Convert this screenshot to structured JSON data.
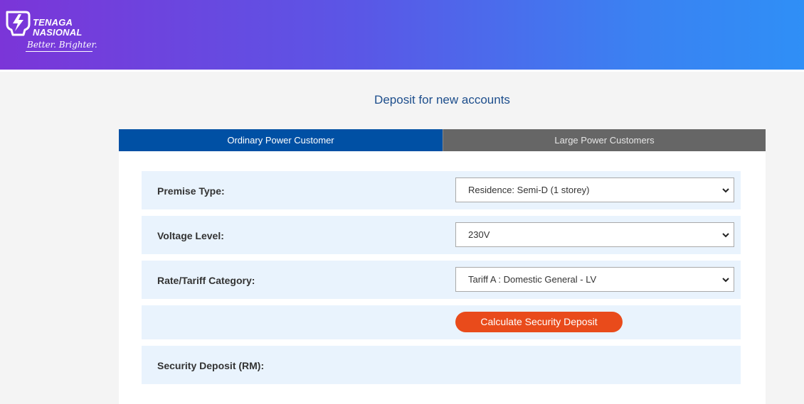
{
  "brand": {
    "name_line1": "TENAGA",
    "name_line2": "NASIONAL",
    "tagline": "Better. Brighter."
  },
  "page": {
    "title": "Deposit for new accounts"
  },
  "tabs": [
    {
      "label": "Ordinary Power Customer",
      "active": true
    },
    {
      "label": "Large Power Customers",
      "active": false
    }
  ],
  "form": {
    "premise_type": {
      "label": "Premise Type:",
      "value": "Residence: Semi-D (1 storey)"
    },
    "voltage_level": {
      "label": "Voltage Level:",
      "value": "230V"
    },
    "tariff_category": {
      "label": "Rate/Tariff Category:",
      "value": "Tariff A : Domestic General - LV"
    },
    "calculate_button": "Calculate Security Deposit",
    "security_deposit": {
      "label": "Security Deposit (RM):",
      "value": ""
    }
  },
  "colors": {
    "header_gradient_start": "#7b35d8",
    "header_gradient_end": "#2f8ff6",
    "tab_active": "#0050a4",
    "tab_inactive": "#666666",
    "row_background": "#e9f3fd",
    "button": "#e94b1b",
    "title_text": "#1d4e8c"
  },
  "icons": {
    "logo": "lightning-bulb-icon",
    "select_arrow": "chevron-down-icon"
  }
}
